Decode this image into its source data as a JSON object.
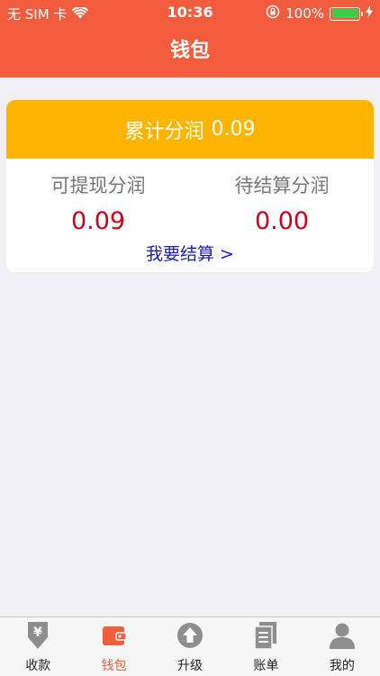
{
  "status_bar": {
    "carrier": "无 SIM 卡",
    "time": "10:36",
    "battery": "100%"
  },
  "nav": {
    "title": "钱包"
  },
  "card": {
    "total_label": "累计分润",
    "total_value": "0.09",
    "withdrawable_label": "可提现分润",
    "withdrawable_value": "0.09",
    "pending_label": "待结算分润",
    "pending_value": "0.00",
    "settle_link": "我要结算 >"
  },
  "tabbar": {
    "items": [
      {
        "label": "收款",
        "icon": "receive-icon"
      },
      {
        "label": "钱包",
        "icon": "wallet-icon",
        "active": true
      },
      {
        "label": "升级",
        "icon": "upgrade-icon"
      },
      {
        "label": "账单",
        "icon": "bill-icon"
      },
      {
        "label": "我的",
        "icon": "profile-icon"
      }
    ]
  },
  "colors": {
    "primary": "#f45c3e",
    "card_header": "#ffb400",
    "value_red": "#d0021b",
    "link_blue": "#1a1ab4",
    "background": "#efeff4"
  }
}
